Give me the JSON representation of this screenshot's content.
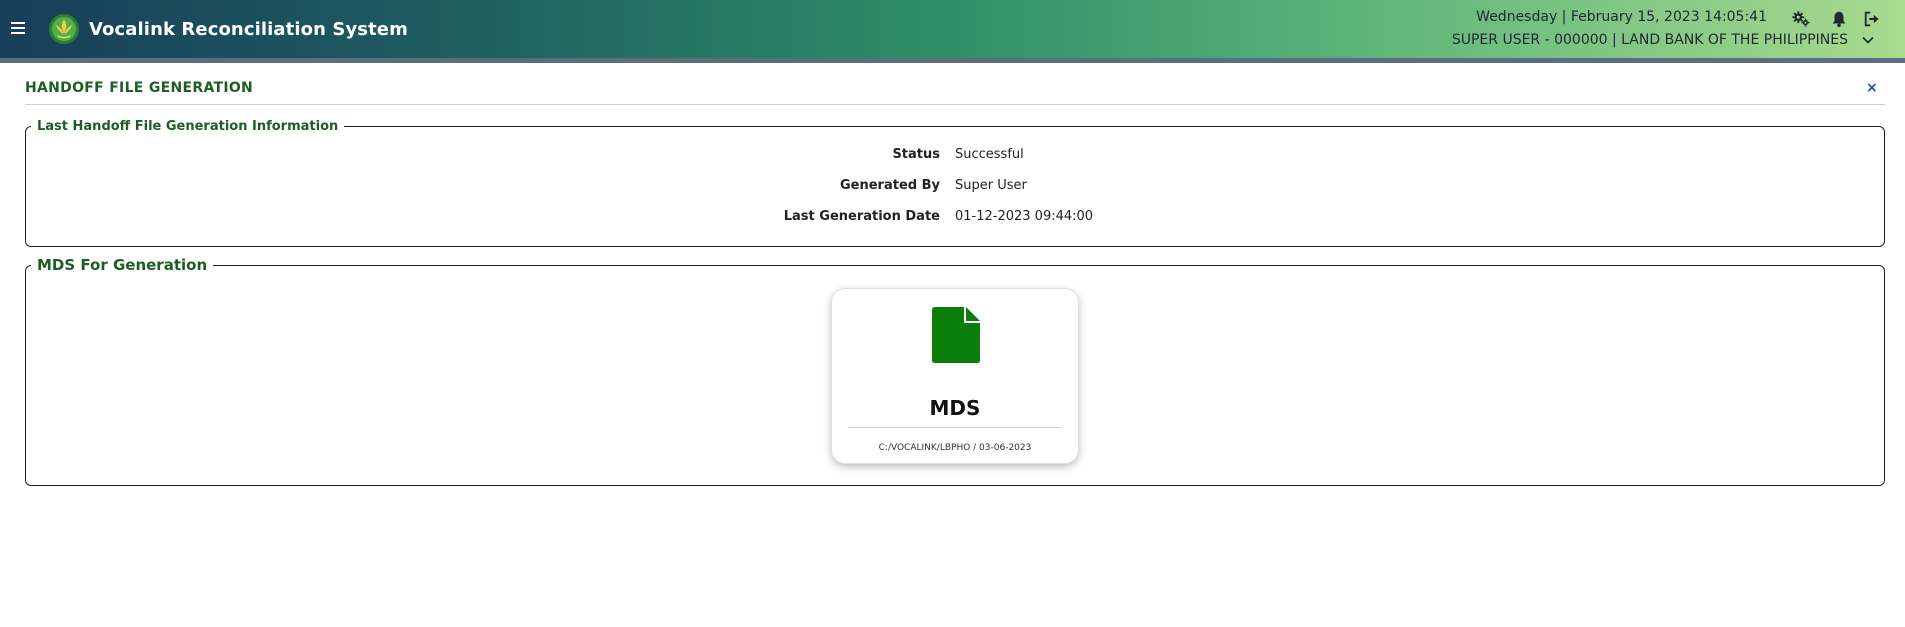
{
  "header": {
    "app_title": "Vocalink Reconciliation System",
    "datetime": "Wednesday | February 15, 2023 14:05:41",
    "user_info": "SUPER USER - 000000 | LAND BANK OF THE PHILIPPINES",
    "icons": [
      "menu-icon",
      "settings-gears-icon",
      "bell-icon",
      "logout-icon",
      "chevron-down-icon"
    ]
  },
  "page": {
    "title": "HANDOFF FILE GENERATION",
    "close_label": "×"
  },
  "last_info": {
    "legend": "Last Handoff File Generation Information",
    "status_label": "Status",
    "status_value": "Successful",
    "generated_by_label": "Generated By",
    "generated_by_value": "Super User",
    "last_date_label": "Last Generation Date",
    "last_date_value": "01-12-2023 09:44:00"
  },
  "mds": {
    "legend": "MDS For Generation",
    "card_title": "MDS",
    "card_path": "C:/VOCALINK/LBPHO / 03-06-2023",
    "card_icon": "file-icon"
  },
  "colors": {
    "accent_green": "#1c5e26",
    "file_icon_green": "#0a7d0a",
    "close_blue": "#1a4fa0"
  }
}
